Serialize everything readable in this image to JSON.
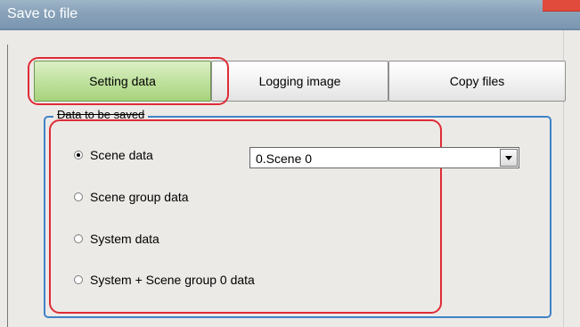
{
  "window": {
    "title": "Save to file"
  },
  "tabs": [
    {
      "label": "Setting data",
      "active": true
    },
    {
      "label": "Logging image",
      "active": false
    },
    {
      "label": "Copy files",
      "active": false
    }
  ],
  "group": {
    "label": "Data to be saved"
  },
  "options": [
    {
      "label": "Scene data",
      "selected": true
    },
    {
      "label": "Scene group data",
      "selected": false
    },
    {
      "label": "System data",
      "selected": false
    },
    {
      "label": "System + Scene group 0 data",
      "selected": false
    }
  ],
  "scene_select": {
    "value": "0.Scene 0"
  },
  "colors": {
    "accent_green": "#a8d27d",
    "highlight_red": "#df2b36",
    "group_blue": "#3f82c6",
    "titlebar_blue": "#87a1b8"
  },
  "icons": {
    "dropdown": "chevron-down-icon",
    "radio": "radio-button-icon"
  }
}
